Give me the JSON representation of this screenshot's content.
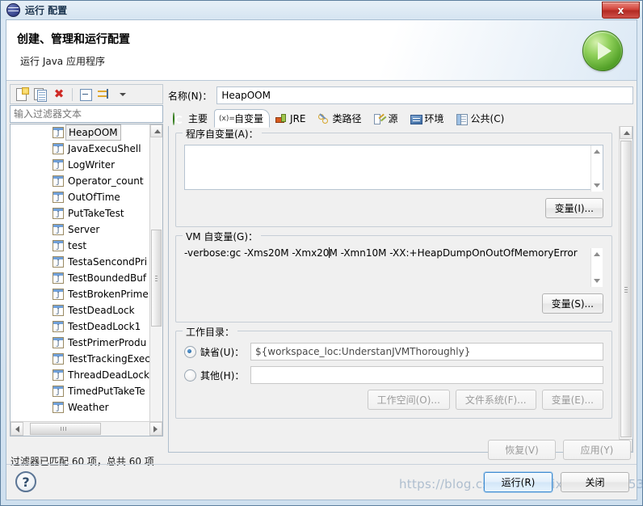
{
  "window": {
    "title": "运行 配置",
    "title_icon": "eclipse-run-icon",
    "close_label": "x"
  },
  "banner": {
    "title": "创建、管理和运行配置",
    "subtitle": "运行 Java 应用程序",
    "icon": "green-run-play-icon"
  },
  "toolbar": {
    "items": [
      {
        "name": "new-launch-configuration",
        "icon": "new-document-icon"
      },
      {
        "name": "duplicate-launch-configuration",
        "icon": "copy-document-icon"
      },
      {
        "name": "delete-launch-configuration",
        "icon": "red-x-delete-icon",
        "glyph": "✖"
      },
      {
        "name": "collapse-all",
        "icon": "collapse-all-icon"
      },
      {
        "name": "filter-launch-configurations",
        "icon": "filter-arrows-icon"
      },
      {
        "name": "view-menu",
        "icon": "chevron-down-icon"
      }
    ]
  },
  "filter": {
    "value": "输入过滤器文本",
    "placeholder": "输入过滤器文本",
    "status": "过滤器已匹配 60 项，总共 60 项"
  },
  "config_list": {
    "items": [
      {
        "label": "HeapOOM",
        "selected": true
      },
      {
        "label": "JavaExecuShell",
        "selected": false
      },
      {
        "label": "LogWriter",
        "selected": false
      },
      {
        "label": "Operator_count",
        "selected": false
      },
      {
        "label": "OutOfTime",
        "selected": false
      },
      {
        "label": "PutTakeTest",
        "selected": false
      },
      {
        "label": "Server",
        "selected": false
      },
      {
        "label": "test",
        "selected": false
      },
      {
        "label": "TestaSencondPri",
        "selected": false
      },
      {
        "label": "TestBoundedBuf",
        "selected": false
      },
      {
        "label": "TestBrokenPrime",
        "selected": false
      },
      {
        "label": "TestDeadLock",
        "selected": false
      },
      {
        "label": "TestDeadLock1",
        "selected": false
      },
      {
        "label": "TestPrimerProdu",
        "selected": false
      },
      {
        "label": "TestTrackingExec",
        "selected": false
      },
      {
        "label": "ThreadDeadLock",
        "selected": false
      },
      {
        "label": "TimedPutTakeTe",
        "selected": false
      },
      {
        "label": "Weather",
        "selected": false
      }
    ]
  },
  "config_name": {
    "label": "名称(N)：",
    "value": "HeapOOM"
  },
  "tabs": [
    {
      "label": "主要",
      "icon": "main-tab-icon",
      "active": false
    },
    {
      "label": "自变量",
      "icon": "arguments-tab-icon",
      "prefix": "(x)=",
      "active": true
    },
    {
      "label": "JRE",
      "icon": "jre-tab-icon",
      "active": false
    },
    {
      "label": "类路径",
      "icon": "classpath-tab-icon",
      "active": false
    },
    {
      "label": "源",
      "icon": "source-tab-icon",
      "active": false
    },
    {
      "label": "环境",
      "icon": "environment-tab-icon",
      "active": false
    },
    {
      "label": "公共(C)",
      "icon": "common-tab-icon",
      "active": false
    }
  ],
  "program_args": {
    "title": "程序自变量(A)：",
    "value": "",
    "variables_button": "变量(I)..."
  },
  "vm_args": {
    "title": "VM 自变量(G)：",
    "value_before_caret": "-verbose:gc -Xms20M -Xmx20",
    "value_after_caret": "M -Xmn10M -XX:+HeapDumpOnOutOfMemoryError",
    "full_value": "-verbose:gc -Xms20M -Xmx20M -Xmn10M -XX:+HeapDumpOnOutOfMemoryError",
    "variables_button": "变量(S)..."
  },
  "working_dir": {
    "title": "工作目录：",
    "default_label": "缺省(U)：",
    "default_value": "${workspace_loc:UnderstanJVMThoroughly}",
    "default_selected": true,
    "other_label": "其他(H)：",
    "other_value": "",
    "other_selected": false,
    "workspace_button": "工作空间(O)...",
    "filesystem_button": "文件系统(F)...",
    "variables_button": "变量(E)..."
  },
  "apply_bar": {
    "revert_label": "恢复(V)",
    "apply_label": "应用(Y)"
  },
  "dialog_buttons": {
    "help_glyph": "?",
    "run_label": "运行(R)",
    "close_label": "关闭"
  },
  "watermark": {
    "text": "https://blog.csdn.net/weixin_41262453"
  },
  "colors": {
    "accent_blue": "#3c8ad0",
    "delete_red": "#cf2b26",
    "run_green": "#4fa526",
    "title_close_red": "#d2443b"
  }
}
